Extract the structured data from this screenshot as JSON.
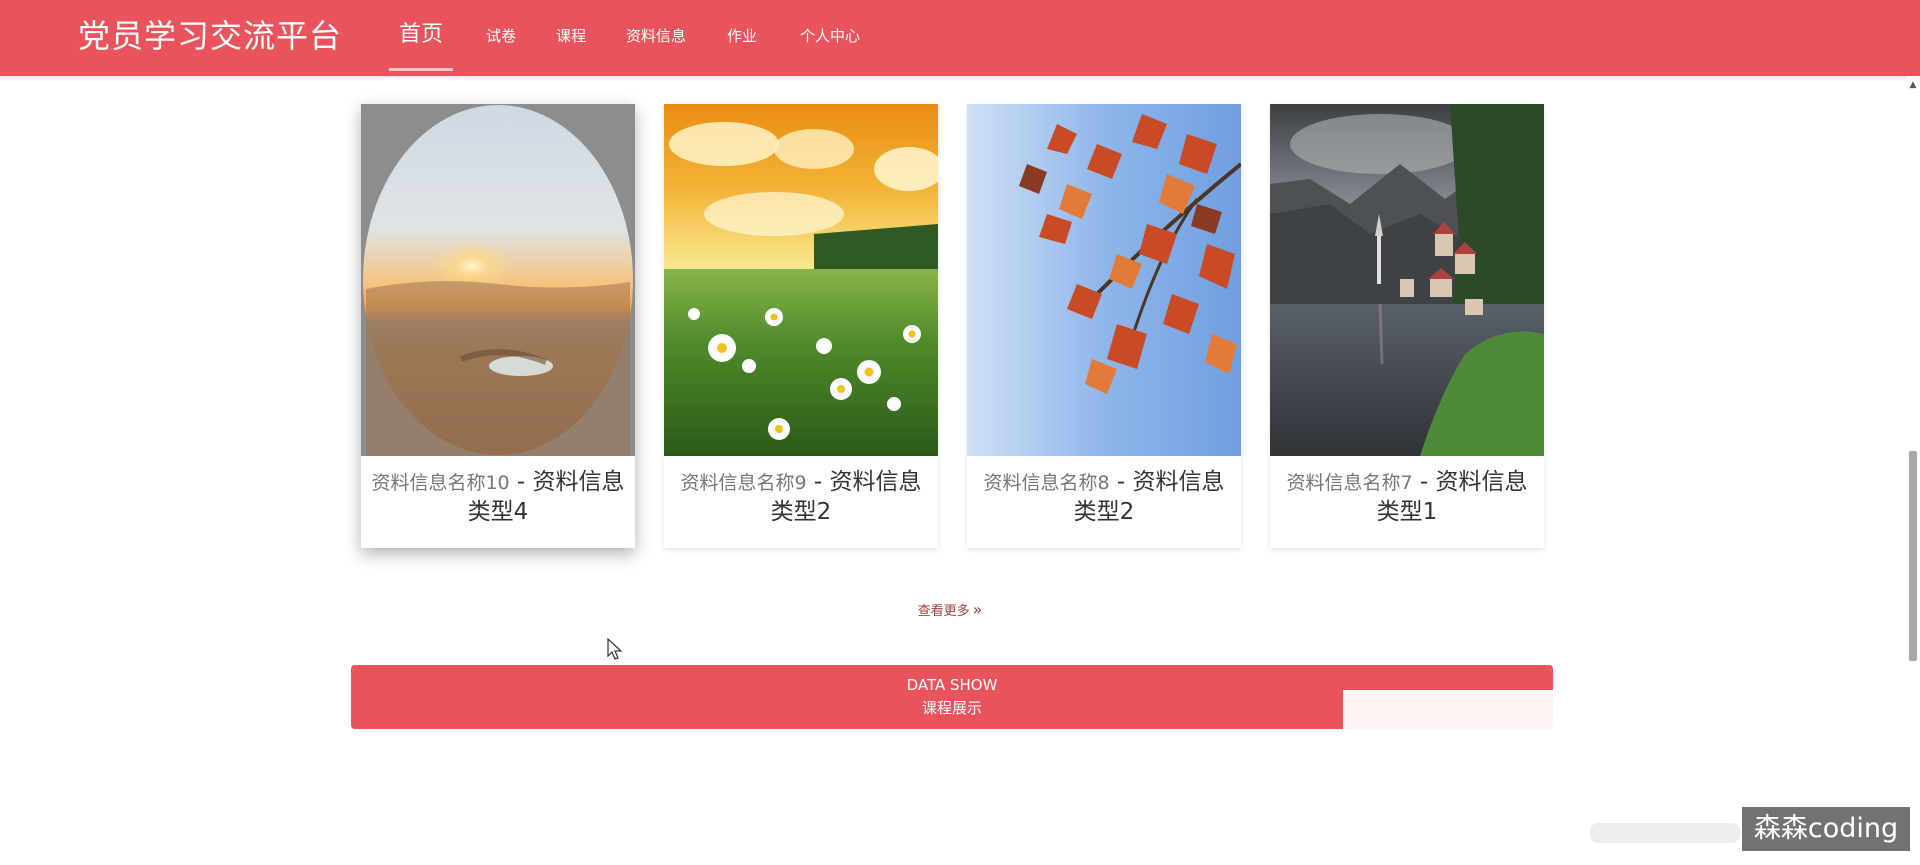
{
  "header": {
    "title": "党员学习交流平台",
    "nav": [
      {
        "label": "首页",
        "active": true
      },
      {
        "label": "试卷",
        "active": false
      },
      {
        "label": "课程",
        "active": false
      },
      {
        "label": "资料信息",
        "active": false
      },
      {
        "label": "作业",
        "active": false
      },
      {
        "label": "个人中心",
        "active": false
      }
    ]
  },
  "cards": [
    {
      "name": "资料信息名称10",
      "separator": " - ",
      "type": "资料信息类型4",
      "image": "desert-sunset-oval-photo"
    },
    {
      "name": "资料信息名称9",
      "separator": " - ",
      "type": "资料信息类型2",
      "image": "daisy-field-photo"
    },
    {
      "name": "资料信息名称8",
      "separator": " - ",
      "type": "资料信息类型2",
      "image": "autumn-leaves-sky-photo"
    },
    {
      "name": "资料信息名称7",
      "separator": " - ",
      "type": "资料信息类型1",
      "image": "lake-village-mountains-photo"
    }
  ],
  "more": {
    "label": "查看更多",
    "icon": "double-chevron-right-icon"
  },
  "section": {
    "title_en": "DATA SHOW",
    "title_cn": "课程展示"
  },
  "watermark": {
    "text": "森森coding"
  },
  "colors": {
    "primary": "#e9535b",
    "link": "#a0413f"
  }
}
